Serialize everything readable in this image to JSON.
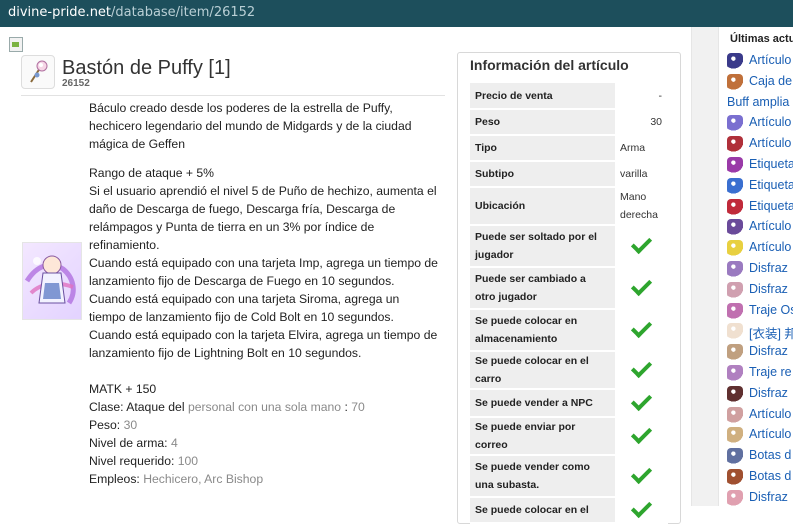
{
  "address_bar": {
    "host": "divine-pride.net",
    "path": "/database/item/26152"
  },
  "item": {
    "name": "Bastón de Puffy [1]",
    "id": "26152",
    "description_intro": "Báculo creado desde los poderes de la estrella de Puffy, hechicero legendario del mundo de Midgards y de la ciudad mágica de Geffen",
    "effect_1": "Rango de ataque + 5%",
    "effect_2": "Si el usuario aprendió el nivel 5 de Puño de hechizo, aumenta el daño de Descarga de fuego, Descarga fría, Descarga de relámpagos y Punta de tierra en un 3% por índice de refinamiento.",
    "combo_lines": [
      "Cuando está equipado con una tarjeta Imp, agrega un tiempo de lanzamiento fijo de Descarga de Fuego en 10 segundos.",
      "Cuando está equipado con una tarjeta Siroma, agrega un tiempo de lanzamiento fijo de Cold Bolt en 10 segundos.",
      "Cuando está equipado con la tarjeta Elvira, agrega un tiempo de lanzamiento fijo de Lightning Bolt en 10 segundos."
    ],
    "matk": "MATK + 150",
    "class_label": "Clase:",
    "class_value": "Ataque del",
    "class_link": "personal con una sola mano",
    "class_sep": ":",
    "class_num": "70",
    "weight_label": "Peso:",
    "weight_value": "30",
    "weapon_level_label": "Nivel de arma:",
    "weapon_level_value": "4",
    "required_level_label": "Nivel requerido:",
    "required_level_value": "100",
    "jobs_label": "Empleos:",
    "jobs_value": "Hechicero, Arc Bishop"
  },
  "info_panel": {
    "title": "Información del artículo",
    "rows": [
      {
        "label": "Precio de venta",
        "value": "-"
      },
      {
        "label": "Peso",
        "value": "30"
      },
      {
        "label": "Tipo",
        "value": "Arma"
      },
      {
        "label": "Subtipo",
        "value": "varilla"
      },
      {
        "label": "Ubicación",
        "value": "Mano derecha"
      },
      {
        "label": "Puede ser soltado por el jugador",
        "value": "check"
      },
      {
        "label": "Puede ser cambiado a otro jugador",
        "value": "check"
      },
      {
        "label": "Se puede colocar en almacenamiento",
        "value": "check"
      },
      {
        "label": "Se puede colocar en el carro",
        "value": "check"
      },
      {
        "label": "Se puede vender a NPC",
        "value": "check"
      },
      {
        "label": "Se puede enviar por correo",
        "value": "check"
      },
      {
        "label": "Se puede vender como una subasta.",
        "value": "check"
      },
      {
        "label": "Se puede colocar en el",
        "value": "check"
      }
    ]
  },
  "latest_updates": {
    "title": "Últimas actu",
    "items": [
      {
        "label": "Artículo",
        "icon_color": "#3a3a8a"
      },
      {
        "label": "Caja de",
        "icon_color": "#c0703a"
      },
      {
        "label": "Buff amplia",
        "icon_color": ""
      },
      {
        "label": "Artículo",
        "icon_color": "#7a6fd0"
      },
      {
        "label": "Artículo",
        "icon_color": "#b0303a"
      },
      {
        "label": "Etiqueta",
        "icon_color": "#9a3aa8"
      },
      {
        "label": "Etiqueta",
        "icon_color": "#3a6fd0"
      },
      {
        "label": "Etiqueta",
        "icon_color": "#c02a3a"
      },
      {
        "label": "Artículo",
        "icon_color": "#6a4a9a"
      },
      {
        "label": "Artículo",
        "icon_color": "#e8d040"
      },
      {
        "label": "Disfraz",
        "icon_color": "#9a7ac0"
      },
      {
        "label": "Disfraz",
        "icon_color": "#d0a0b0"
      },
      {
        "label": "Traje Os",
        "icon_color": "#c070b0"
      },
      {
        "label": "[衣装] 邦",
        "icon_color": "#f0e0d0"
      },
      {
        "label": "Disfraz",
        "icon_color": "#c0a080"
      },
      {
        "label": "Traje re",
        "icon_color": "#b080c0"
      },
      {
        "label": "Disfraz",
        "icon_color": "#603030"
      },
      {
        "label": "Artículo",
        "icon_color": "#d0a0a0"
      },
      {
        "label": "Artículo",
        "icon_color": "#d0b080"
      },
      {
        "label": "Botas d",
        "icon_color": "#6070a0"
      },
      {
        "label": "Botas d",
        "icon_color": "#a05030"
      },
      {
        "label": "Disfraz",
        "icon_color": "#e0a0b0"
      }
    ]
  }
}
